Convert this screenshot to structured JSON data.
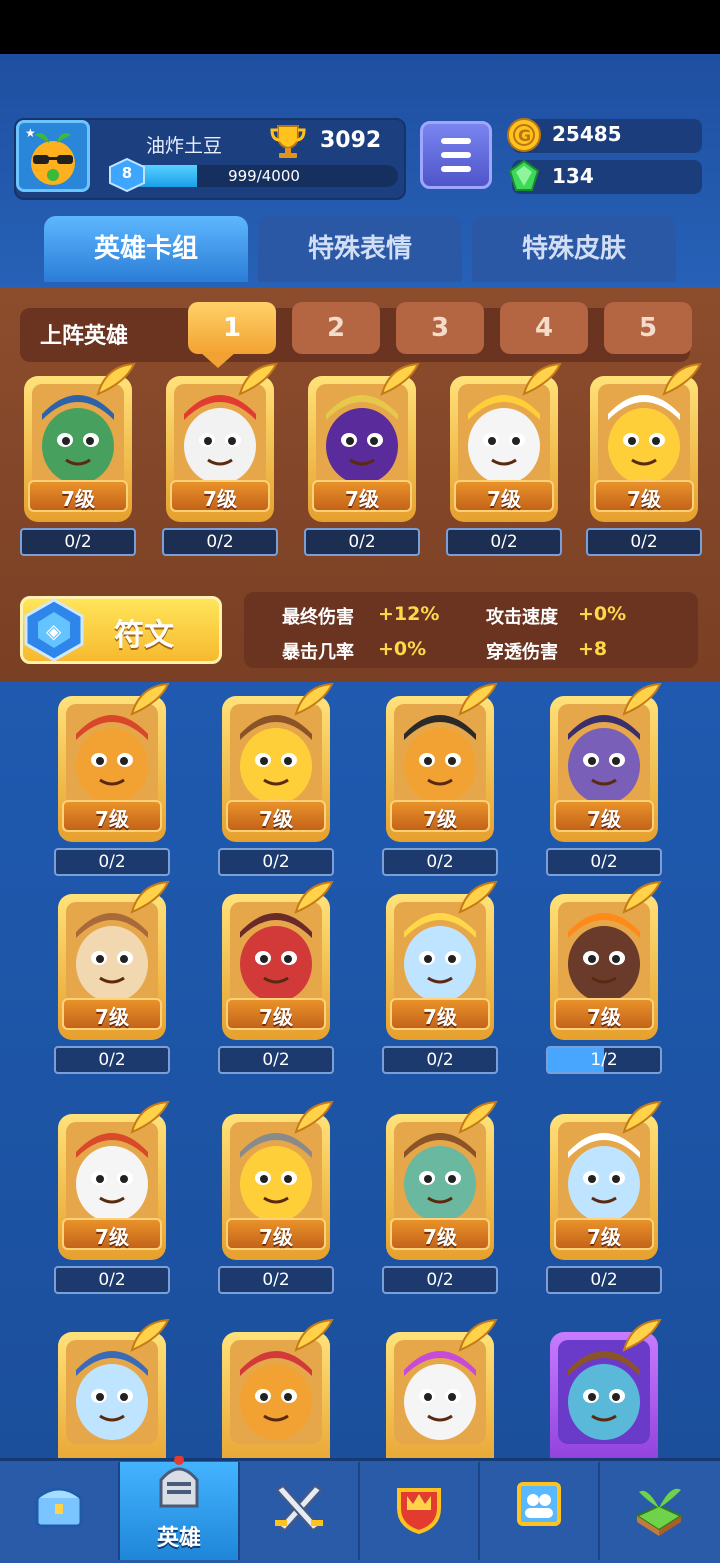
{
  "player": {
    "name": "油炸土豆",
    "trophies": "3092",
    "level": "8",
    "xp_text": "999/4000",
    "xp_progress": 0.25
  },
  "currency": {
    "coins": "25485",
    "gems": "134"
  },
  "tabs": [
    {
      "label": "英雄卡组",
      "active": true
    },
    {
      "label": "特殊表情",
      "active": false
    },
    {
      "label": "特殊皮肤",
      "active": false
    }
  ],
  "deck": {
    "label": "上阵英雄",
    "slots": [
      "1",
      "2",
      "3",
      "4",
      "5"
    ],
    "active_slot": "1",
    "heroes": [
      {
        "name": "police-hero",
        "level": "7级",
        "progress": "0/2"
      },
      {
        "name": "clown-hero",
        "level": "7级",
        "progress": "0/2"
      },
      {
        "name": "mage-hero",
        "level": "7级",
        "progress": "0/2"
      },
      {
        "name": "ghost-hero",
        "level": "7级",
        "progress": "0/2"
      },
      {
        "name": "chef-hero",
        "level": "7级",
        "progress": "0/2"
      }
    ]
  },
  "rune": {
    "label": "符文",
    "stats": [
      {
        "label": "最终伤害",
        "value": "+12%"
      },
      {
        "label": "攻击速度",
        "value": "+0%"
      },
      {
        "label": "暴击几率",
        "value": "+0%"
      },
      {
        "label": "穿透伤害",
        "value": "+8"
      }
    ]
  },
  "collection": [
    {
      "name": "monkey-king-hero",
      "level": "7级",
      "progress": "0/2",
      "fill": 0
    },
    {
      "name": "cowboy-hero",
      "level": "7级",
      "progress": "0/2",
      "fill": 0
    },
    {
      "name": "ninja-hero",
      "level": "7级",
      "progress": "0/2",
      "fill": 0
    },
    {
      "name": "octopus-pirate-hero",
      "level": "7级",
      "progress": "0/2",
      "fill": 0
    },
    {
      "name": "minotaur-hero",
      "level": "7级",
      "progress": "0/2",
      "fill": 0
    },
    {
      "name": "detective-hero",
      "level": "7级",
      "progress": "0/2",
      "fill": 0
    },
    {
      "name": "zeus-hero",
      "level": "7级",
      "progress": "0/2",
      "fill": 0
    },
    {
      "name": "magma-golem-hero",
      "level": "7级",
      "progress": "1/2",
      "fill": 0.5
    },
    {
      "name": "assassin-hero",
      "level": "7级",
      "progress": "0/2",
      "fill": 0
    },
    {
      "name": "knight-hero",
      "level": "7级",
      "progress": "0/2",
      "fill": 0
    },
    {
      "name": "bandit-hero",
      "level": "7级",
      "progress": "0/2",
      "fill": 0
    },
    {
      "name": "yeti-hero",
      "level": "7级",
      "progress": "0/2",
      "fill": 0
    },
    {
      "name": "ice-viking-hero",
      "level": "",
      "progress": "",
      "fill": 0
    },
    {
      "name": "spartan-hero",
      "level": "",
      "progress": "",
      "fill": 0
    },
    {
      "name": "skull-hero",
      "level": "",
      "progress": "",
      "fill": 0
    },
    {
      "name": "epic-hero",
      "level": "",
      "progress": "",
      "fill": 0
    }
  ],
  "nav": [
    {
      "icon": "treasure-chest-icon",
      "label": ""
    },
    {
      "icon": "knight-helmet-icon",
      "label": "英雄"
    },
    {
      "icon": "crossed-swords-icon",
      "label": ""
    },
    {
      "icon": "shield-crown-icon",
      "label": ""
    },
    {
      "icon": "team-banner-icon",
      "label": ""
    },
    {
      "icon": "sprout-island-icon",
      "label": ""
    }
  ],
  "colors": {
    "gold": "#f2a232",
    "accent_blue": "#2a7dd6",
    "panel_brown": "#7a3f24",
    "stat_yellow": "#ffd84a"
  }
}
